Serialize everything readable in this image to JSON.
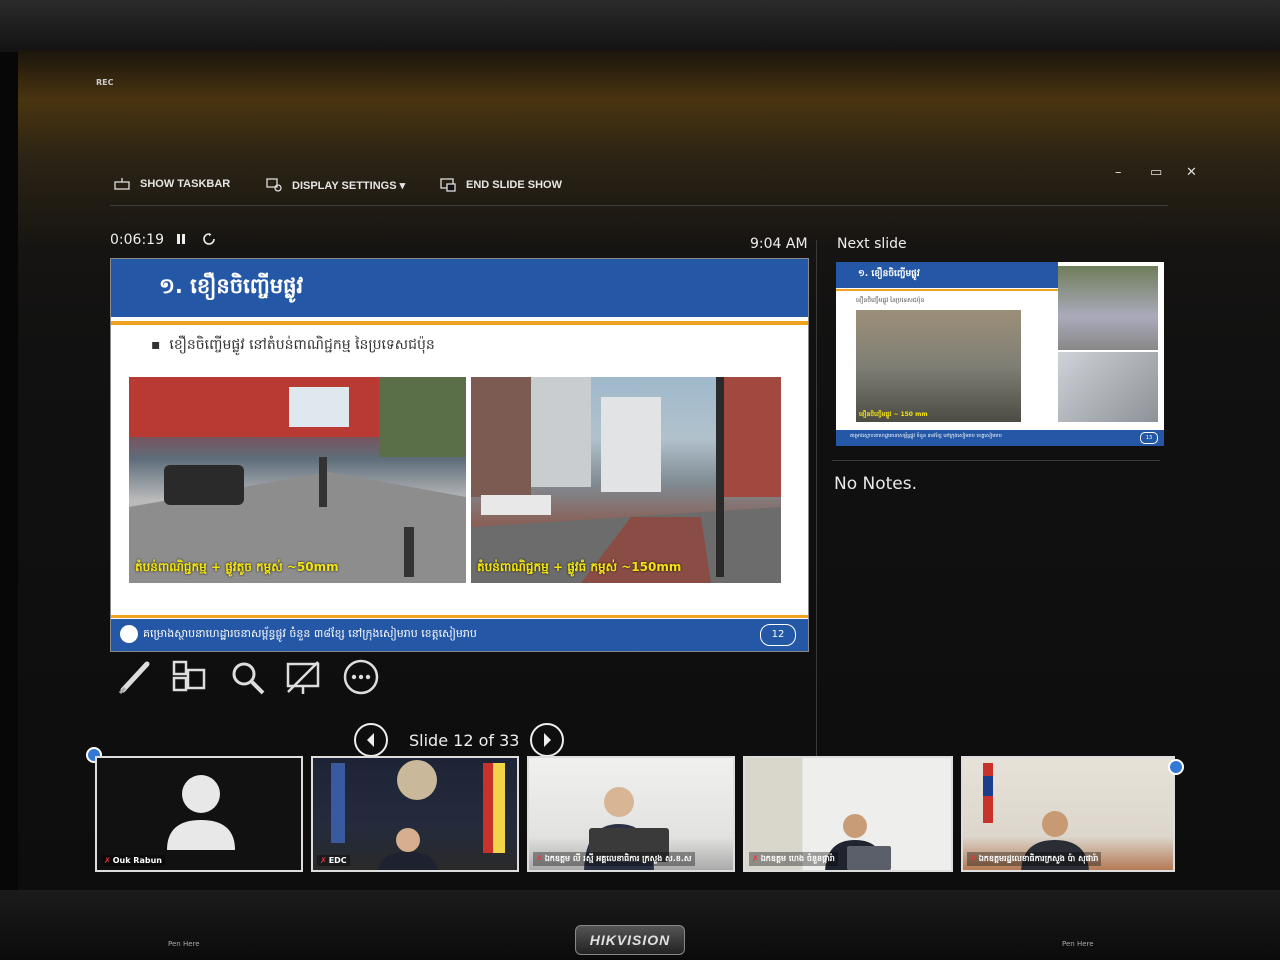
{
  "recording": {
    "label": "REC"
  },
  "window_controls": {
    "minimize": "–",
    "restore": "▭",
    "close": "✕"
  },
  "toolbar": {
    "show_taskbar": "SHOW TASKBAR",
    "display_settings": "DISPLAY SETTINGS ▾",
    "end_slide_show": "END SLIDE SHOW"
  },
  "presenter": {
    "elapsed_time": "0:06:19",
    "clock": "9:04 AM",
    "next_slide_label": "Next slide",
    "notes": "No Notes.",
    "slide_counter": "Slide 12 of 33"
  },
  "current_slide": {
    "title": "១. ខឿនចិញ្ចើមផ្លូវ",
    "bullet": "ខឿនចិញ្ចើមផ្លូវ នៅតំបន់ពាណិជ្ជកម្ម នៃប្រទេសជប៉ុន",
    "photo_captions": [
      "តំបន់ពាណិជ្ជកម្ម + ផ្លូវតូច កម្ពស់ ~50mm",
      "តំបន់ពាណិជ្ជកម្ម + ផ្លូវធំ កម្ពស់ ~150mm"
    ],
    "footer_text": "គម្រោងស្ថាបនាហេដ្ឋារចនាសម្ព័ន្ធផ្លូវ ចំនួន ៣៨ខ្សែ នៅក្រុងសៀមរាប ខេត្តសៀមរាប",
    "page_number": "12"
  },
  "next_slide": {
    "title": "១. ខឿនចិញ្ចើមផ្លូវ",
    "bullet": "ខឿនចិញ្ចើមផ្លូវ នៃប្រទេសជប៉ុន",
    "photo_caption": "ខឿនចិញ្ចើមផ្លូវ ~ 150 mm",
    "page_number": "13"
  },
  "participants": [
    {
      "name": "Ouk Rabun"
    },
    {
      "name": "EDC"
    },
    {
      "name": "ឯកឧត្តម លី រស្មី អគ្គលេខាធិការ ក្រសួង ស.ខ.ស"
    },
    {
      "name": "ឯកឧត្តម ហេង ចំនួនផ្ការ៉ា"
    },
    {
      "name": "ឯកឧត្តមរដ្ឋលេខាធិការក្រសួង ប៉ា សុផារ៉ា"
    }
  ],
  "monitor": {
    "brand": "HIKVISION",
    "pen_label": "Pen Here"
  },
  "colors": {
    "slide_blue": "#2457a6",
    "slide_orange": "#f0a21f",
    "caption_yellow": "#f4e414"
  }
}
